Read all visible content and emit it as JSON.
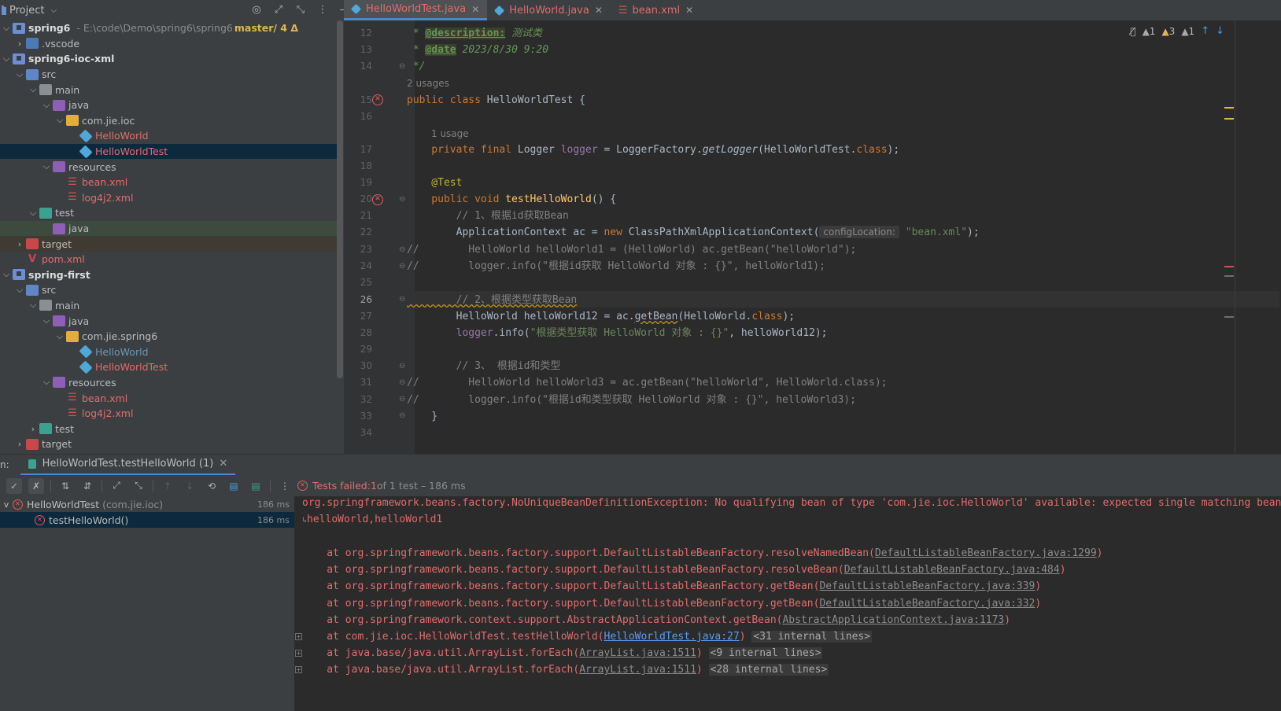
{
  "project": {
    "title": "Project",
    "tree": [
      {
        "label": "spring6",
        "note": "- E:\\code\\Demo\\spring6\\spring6",
        "branch": "master/ 4 Δ",
        "indent": 0,
        "arrow": "v",
        "icon": "module",
        "style": "bold"
      },
      {
        "label": ".vscode",
        "indent": 1,
        "arrow": ">",
        "icon": "folder-vs",
        "style": "normal"
      },
      {
        "label": "spring6-ioc-xml",
        "indent": 0,
        "arrow": "v",
        "icon": "module",
        "style": "bold"
      },
      {
        "label": "src",
        "indent": 1,
        "arrow": "v",
        "icon": "folder-blue",
        "style": "normal"
      },
      {
        "label": "main",
        "indent": 2,
        "arrow": "v",
        "icon": "folder-gray",
        "style": "normal"
      },
      {
        "label": "java",
        "indent": 3,
        "arrow": "v",
        "icon": "folder-purple",
        "style": "normal"
      },
      {
        "label": "com.jie.ioc",
        "indent": 4,
        "arrow": "v",
        "icon": "folder-yellow",
        "style": "normal"
      },
      {
        "label": "HelloWorld",
        "indent": 5,
        "arrow": "",
        "icon": "class",
        "style": "red"
      },
      {
        "label": "HelloWorldTest",
        "indent": 5,
        "arrow": "",
        "icon": "class",
        "style": "red",
        "row": "selected"
      },
      {
        "label": "resources",
        "indent": 3,
        "arrow": "v",
        "icon": "folder-purple",
        "style": "normal"
      },
      {
        "label": "bean.xml",
        "indent": 4,
        "arrow": "",
        "icon": "xml",
        "style": "red"
      },
      {
        "label": "log4j2.xml",
        "indent": 4,
        "arrow": "",
        "icon": "xml",
        "style": "red"
      },
      {
        "label": "test",
        "indent": 2,
        "arrow": "v",
        "icon": "folder-teal",
        "style": "normal"
      },
      {
        "label": "java",
        "indent": 3,
        "arrow": "",
        "icon": "folder-purple",
        "style": "normal",
        "row": "hl-green"
      },
      {
        "label": "target",
        "indent": 1,
        "arrow": ">",
        "icon": "folder-red",
        "style": "normal",
        "row": "hl-brown"
      },
      {
        "label": "pom.xml",
        "indent": 1,
        "arrow": "",
        "icon": "pom",
        "style": "red"
      },
      {
        "label": "spring-first",
        "indent": 0,
        "arrow": "v",
        "icon": "module",
        "style": "bold"
      },
      {
        "label": "src",
        "indent": 1,
        "arrow": "v",
        "icon": "folder-blue",
        "style": "normal"
      },
      {
        "label": "main",
        "indent": 2,
        "arrow": "v",
        "icon": "folder-gray",
        "style": "normal"
      },
      {
        "label": "java",
        "indent": 3,
        "arrow": "v",
        "icon": "folder-purple",
        "style": "normal"
      },
      {
        "label": "com.jie.spring6",
        "indent": 4,
        "arrow": "v",
        "icon": "folder-yellow",
        "style": "normal"
      },
      {
        "label": "HelloWorld",
        "indent": 5,
        "arrow": "",
        "icon": "class",
        "style": "blue"
      },
      {
        "label": "HelloWorldTest",
        "indent": 5,
        "arrow": "",
        "icon": "class",
        "style": "red"
      },
      {
        "label": "resources",
        "indent": 3,
        "arrow": "v",
        "icon": "folder-purple",
        "style": "normal"
      },
      {
        "label": "bean.xml",
        "indent": 4,
        "arrow": "",
        "icon": "xml",
        "style": "red"
      },
      {
        "label": "log4j2.xml",
        "indent": 4,
        "arrow": "",
        "icon": "xml",
        "style": "red"
      },
      {
        "label": "test",
        "indent": 2,
        "arrow": ">",
        "icon": "folder-teal",
        "style": "normal"
      },
      {
        "label": "target",
        "indent": 1,
        "arrow": ">",
        "icon": "folder-red",
        "style": "normal"
      }
    ]
  },
  "tabs": [
    {
      "label": "HelloWorldTest.java",
      "kind": "class",
      "active": true
    },
    {
      "label": "HelloWorld.java",
      "kind": "class",
      "active": false
    },
    {
      "label": "bean.xml",
      "kind": "xml",
      "active": false
    }
  ],
  "editor_status": {
    "errors": "1",
    "warnings": "3",
    "weak": "1"
  },
  "editor": {
    "line_numbers": [
      "12",
      "13",
      "14",
      "15",
      "16",
      "17",
      "18",
      "19",
      "20",
      "21",
      "22",
      "23",
      "24",
      "25",
      "26",
      "27",
      "28",
      "29",
      "30",
      "31",
      "32",
      "33",
      "34"
    ],
    "current_line": "26",
    "usages_class": "2 usages",
    "usages_logger": "1 usage",
    "l12_star": " * ",
    "l12_tag": "@description:",
    "l12_text": " 测试类",
    "l13_star": " * ",
    "l13_tag": "@date",
    "l13_text": " 2023/8/30 9:20",
    "l14": " */",
    "l15_kw": "public class ",
    "l15_name": "HelloWorldTest {",
    "l17_kw": "    private final ",
    "l17_type": "Logger ",
    "l17_field": "logger",
    "l17_rest": " = LoggerFactory.",
    "l17_call": "getLogger",
    "l17_arg": "(HelloWorldTest.",
    "l17_class": "class",
    "l17_end": ");",
    "l19": "    @Test",
    "l20_kw": "    public void ",
    "l20_fn": "testHelloWorld",
    "l20_end": "() {",
    "l21": "        // 1、根据id获取Bean",
    "l22_a": "        ApplicationContext ac = ",
    "l22_new": "new ",
    "l22_b": "ClassPathXmlApplicationContext(",
    "l22_hint": "configLocation:",
    "l22_str": "\"bean.xml\"",
    "l22_end": ");",
    "l23": "//        HelloWorld helloWorld1 = (HelloWorld) ac.getBean(\"helloWorld\");",
    "l24": "//        logger.info(\"根据id获取 HelloWorld 对象 : {}\", helloWorld1);",
    "l26": "        // 2、根据类型获取Bean",
    "l27_a": "        HelloWorld helloWorld12 = ac.",
    "l27_call": "getBean",
    "l27_b": "(HelloWorld.",
    "l27_class": "class",
    "l27_end": ");",
    "l28_a": "        ",
    "l28_field": "logger",
    "l28_b": ".info(",
    "l28_str": "\"根据类型获取 HelloWorld 对象 : {}\"",
    "l28_end": ", helloWorld12);",
    "l30": "        // 3、 根据id和类型",
    "l31": "//        HelloWorld helloWorld3 = ac.getBean(\"helloWorld\", HelloWorld.class);",
    "l32": "//        logger.info(\"根据id和类型获取 HelloWorld 对象 : {}\", helloWorld3);",
    "l33": "    }"
  },
  "run": {
    "prefix": "n:",
    "tab_label": "HelloWorldTest.testHelloWorld (1)",
    "status_prefix": "Tests failed: ",
    "status_count": "1",
    "status_rest": " of 1 test – 186 ms",
    "tree": [
      {
        "label": "HelloWorldTest",
        "pkg": "(com.jie.ioc)",
        "dur": "186 ms",
        "indent": 0
      },
      {
        "label": "testHelloWorld()",
        "pkg": "",
        "dur": "186 ms",
        "indent": 1
      }
    ],
    "exception_line1": "org.springframework.beans.factory.NoUniqueBeanDefinitionException: No qualifying bean of type 'com.jie.ioc.HelloWorld' available: expected single matching bean but found 2: ",
    "exception_line2": "helloWorld,helloWorld1",
    "stack": [
      {
        "text": "    at org.springframework.beans.factory.support.DefaultListableBeanFactory.resolveNamedBean(",
        "link": "DefaultListableBeanFactory.java:1299",
        "end": ")",
        "internal": "",
        "expand": false,
        "blue": false
      },
      {
        "text": "    at org.springframework.beans.factory.support.DefaultListableBeanFactory.resolveBean(",
        "link": "DefaultListableBeanFactory.java:484",
        "end": ")",
        "internal": "",
        "expand": false,
        "blue": false
      },
      {
        "text": "    at org.springframework.beans.factory.support.DefaultListableBeanFactory.getBean(",
        "link": "DefaultListableBeanFactory.java:339",
        "end": ")",
        "internal": "",
        "expand": false,
        "blue": false
      },
      {
        "text": "    at org.springframework.beans.factory.support.DefaultListableBeanFactory.getBean(",
        "link": "DefaultListableBeanFactory.java:332",
        "end": ")",
        "internal": "",
        "expand": false,
        "blue": false
      },
      {
        "text": "    at org.springframework.context.support.AbstractApplicationContext.getBean(",
        "link": "AbstractApplicationContext.java:1173",
        "end": ")",
        "internal": "",
        "expand": false,
        "blue": false
      },
      {
        "text": "    at com.jie.ioc.HelloWorldTest.testHelloWorld(",
        "link": "HelloWorldTest.java:27",
        "end": ")",
        "internal": "<31 internal lines>",
        "expand": true,
        "blue": true
      },
      {
        "text": "    at java.base/java.util.ArrayList.forEach(",
        "link": "ArrayList.java:1511",
        "end": ")",
        "internal": "<9 internal lines>",
        "expand": true,
        "blue": false
      },
      {
        "text": "    at java.base/java.util.ArrayList.forEach(",
        "link": "ArrayList.java:1511",
        "end": ")",
        "internal": "<28 internal lines>",
        "expand": true,
        "blue": false
      }
    ]
  }
}
